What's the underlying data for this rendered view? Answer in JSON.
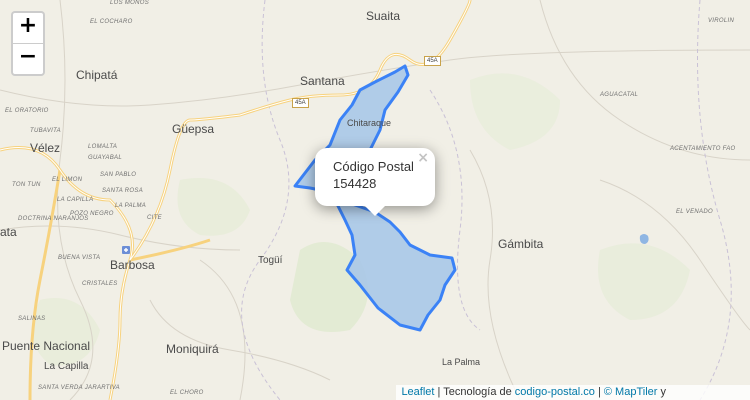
{
  "zoom": {
    "in_label": "+",
    "out_label": "−"
  },
  "towns": {
    "suaita": "Suaita",
    "chipata": "Chipatá",
    "santana": "Santana",
    "chitaraque": "Chitaraque",
    "guepsa": "Güepsa",
    "velez": "Vélez",
    "barbosa": "Barbosa",
    "togui": "Togüí",
    "gambita": "Gámbita",
    "puente_nacional": "Puente Nacional",
    "moniquira": "Moniquirá",
    "la_palma": "La Palma",
    "la_capilla": "La Capilla",
    "ata_left": "ata"
  },
  "small_labels": [
    "EL COCHARO",
    "LOS MONOS",
    "EL ORATORIO",
    "TUBAVITA",
    "LOMALTA",
    "GUAYABAL",
    "SAN PABLO",
    "EL LIMON",
    "TON TUN",
    "SANTA ROSA",
    "LA CAPILLA",
    "LA PALMA",
    "POZO NEGRO",
    "CITE",
    "DOCTRINA NARANJOS",
    "BUENA VISTA",
    "CRISTALES",
    "SALINAS",
    "SANTA VERDA JARARTIVA",
    "EL CHORO",
    "VIROLIN",
    "AGUACATAL",
    "ACENTAMIENTO FAO",
    "EL VENADO"
  ],
  "roads": {
    "road_45a_top": "45A",
    "road_45a_mid": "45A"
  },
  "popup": {
    "title": "Código Postal",
    "value": "154428",
    "close": "×"
  },
  "attribution": {
    "leaflet": "Leaflet",
    "sep1": " | Tecnología de ",
    "codigo": "codigo-postal.co",
    "sep2": " | ",
    "maptiler": "© MapTiler",
    "tail": " y"
  },
  "colors": {
    "polygon_fill": "#a9c8e8",
    "polygon_stroke": "#3b82f6",
    "road_major": "#f7d27e",
    "background": "#f1efe6"
  }
}
